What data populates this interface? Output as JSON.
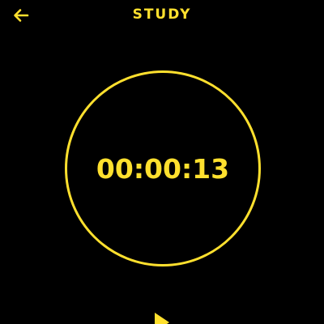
{
  "header": {
    "title": "STUDY",
    "back_icon": "arrow-left-icon"
  },
  "timer": {
    "time": "00:00:13"
  },
  "controls": {
    "play_icon": "play-icon"
  },
  "colors": {
    "accent": "#FFE02E",
    "background": "#000000"
  }
}
